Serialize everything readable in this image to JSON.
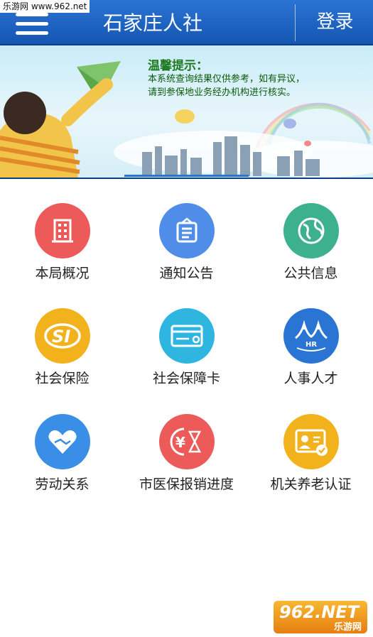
{
  "watermark_top": "乐游网 www.962.net",
  "header": {
    "title": "石家庄人社",
    "login": "登录"
  },
  "banner": {
    "tip_title": "温馨提示：",
    "tip_line1": "本系统查询结果仅供参考，如有异议，",
    "tip_line2": "请到参保地业务经办机构进行核实。"
  },
  "menu_items": [
    {
      "label": "本局概况",
      "color": "#ec5a5a",
      "icon": "building-icon"
    },
    {
      "label": "通知公告",
      "color": "#4f8de8",
      "icon": "notice-board-icon"
    },
    {
      "label": "公共信息",
      "color": "#3db08e",
      "icon": "globe-icon"
    },
    {
      "label": "社会保险",
      "color": "#f2b21c",
      "icon": "si-logo-icon"
    },
    {
      "label": "社会保障卡",
      "color": "#2fb6e0",
      "icon": "card-icon"
    },
    {
      "label": "人事人才",
      "color": "#2a74d4",
      "icon": "hr-logo-icon"
    },
    {
      "label": "劳动关系",
      "color": "#3a8ee6",
      "icon": "handshake-heart-icon"
    },
    {
      "label": "市医保报销进度",
      "color": "#ec5a5a",
      "icon": "yuan-hourglass-icon"
    },
    {
      "label": "机关养老认证",
      "color": "#f2b21c",
      "icon": "id-card-check-icon"
    }
  ],
  "watermark_bottom": {
    "brand": "962.NET",
    "sub": "乐游网"
  }
}
